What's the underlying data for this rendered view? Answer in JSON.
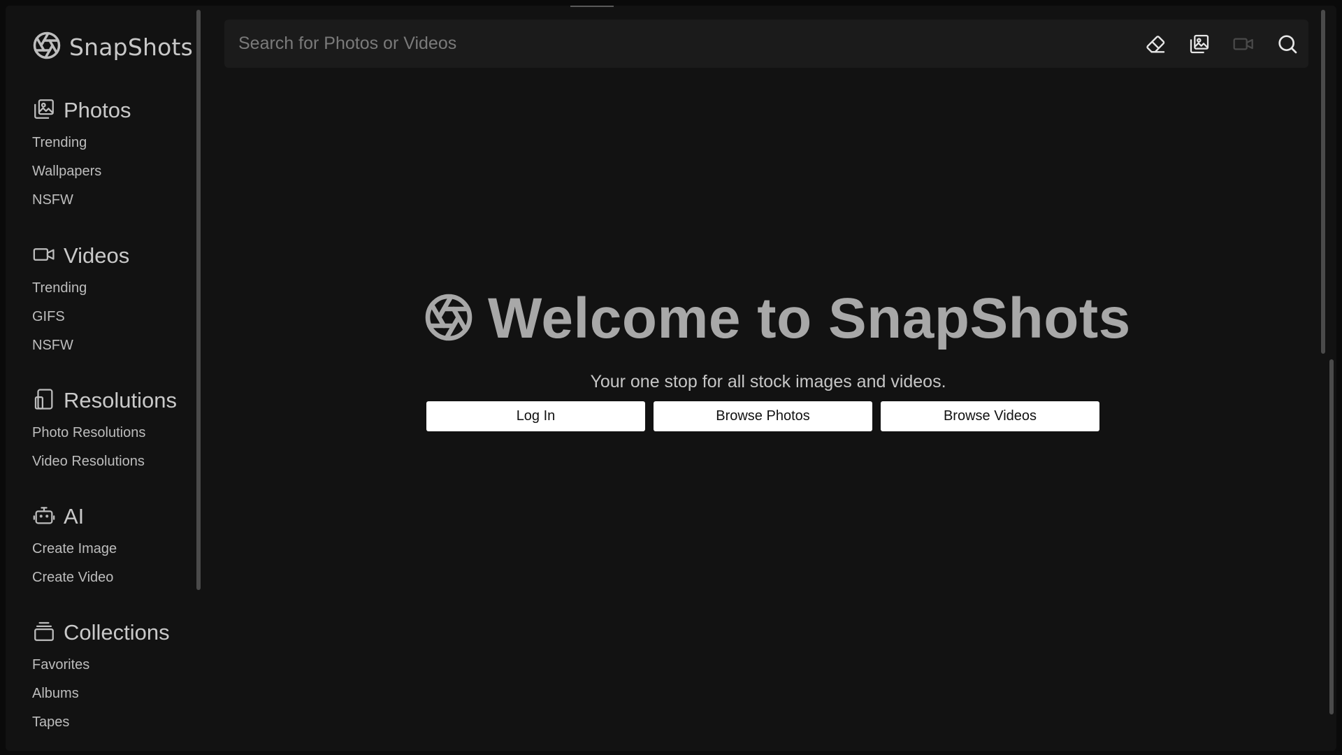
{
  "app": {
    "name": "SnapShots"
  },
  "search": {
    "placeholder": "Search for Photos or Videos",
    "value": "",
    "icons": [
      "eraser-icon",
      "photo-library-icon",
      "video-camera-icon",
      "search-icon"
    ]
  },
  "sidebar": {
    "sections": [
      {
        "title": "Photos",
        "icon": "photo-library-icon",
        "links": [
          "Trending",
          "Wallpapers",
          "NSFW"
        ]
      },
      {
        "title": "Videos",
        "icon": "video-camera-icon",
        "links": [
          "Trending",
          "GIFS",
          "NSFW"
        ]
      },
      {
        "title": "Resolutions",
        "icon": "device-resolution-icon",
        "links": [
          "Photo Resolutions",
          "Video Resolutions"
        ]
      },
      {
        "title": "AI",
        "icon": "robot-icon",
        "links": [
          "Create Image",
          "Create Video"
        ]
      },
      {
        "title": "Collections",
        "icon": "collections-stack-icon",
        "links": [
          "Favorites",
          "Albums",
          "Tapes"
        ]
      }
    ]
  },
  "hero": {
    "title": "Welcome to SnapShots",
    "subtitle": "Your one stop for all stock images and videos.",
    "buttons": [
      "Log In",
      "Browse Photos",
      "Browse Videos"
    ]
  },
  "colors": {
    "background": "#121212",
    "search_bar": "#1b1b1b",
    "button_bg": "#ffffff",
    "hero_title": "#a8a8a8"
  }
}
